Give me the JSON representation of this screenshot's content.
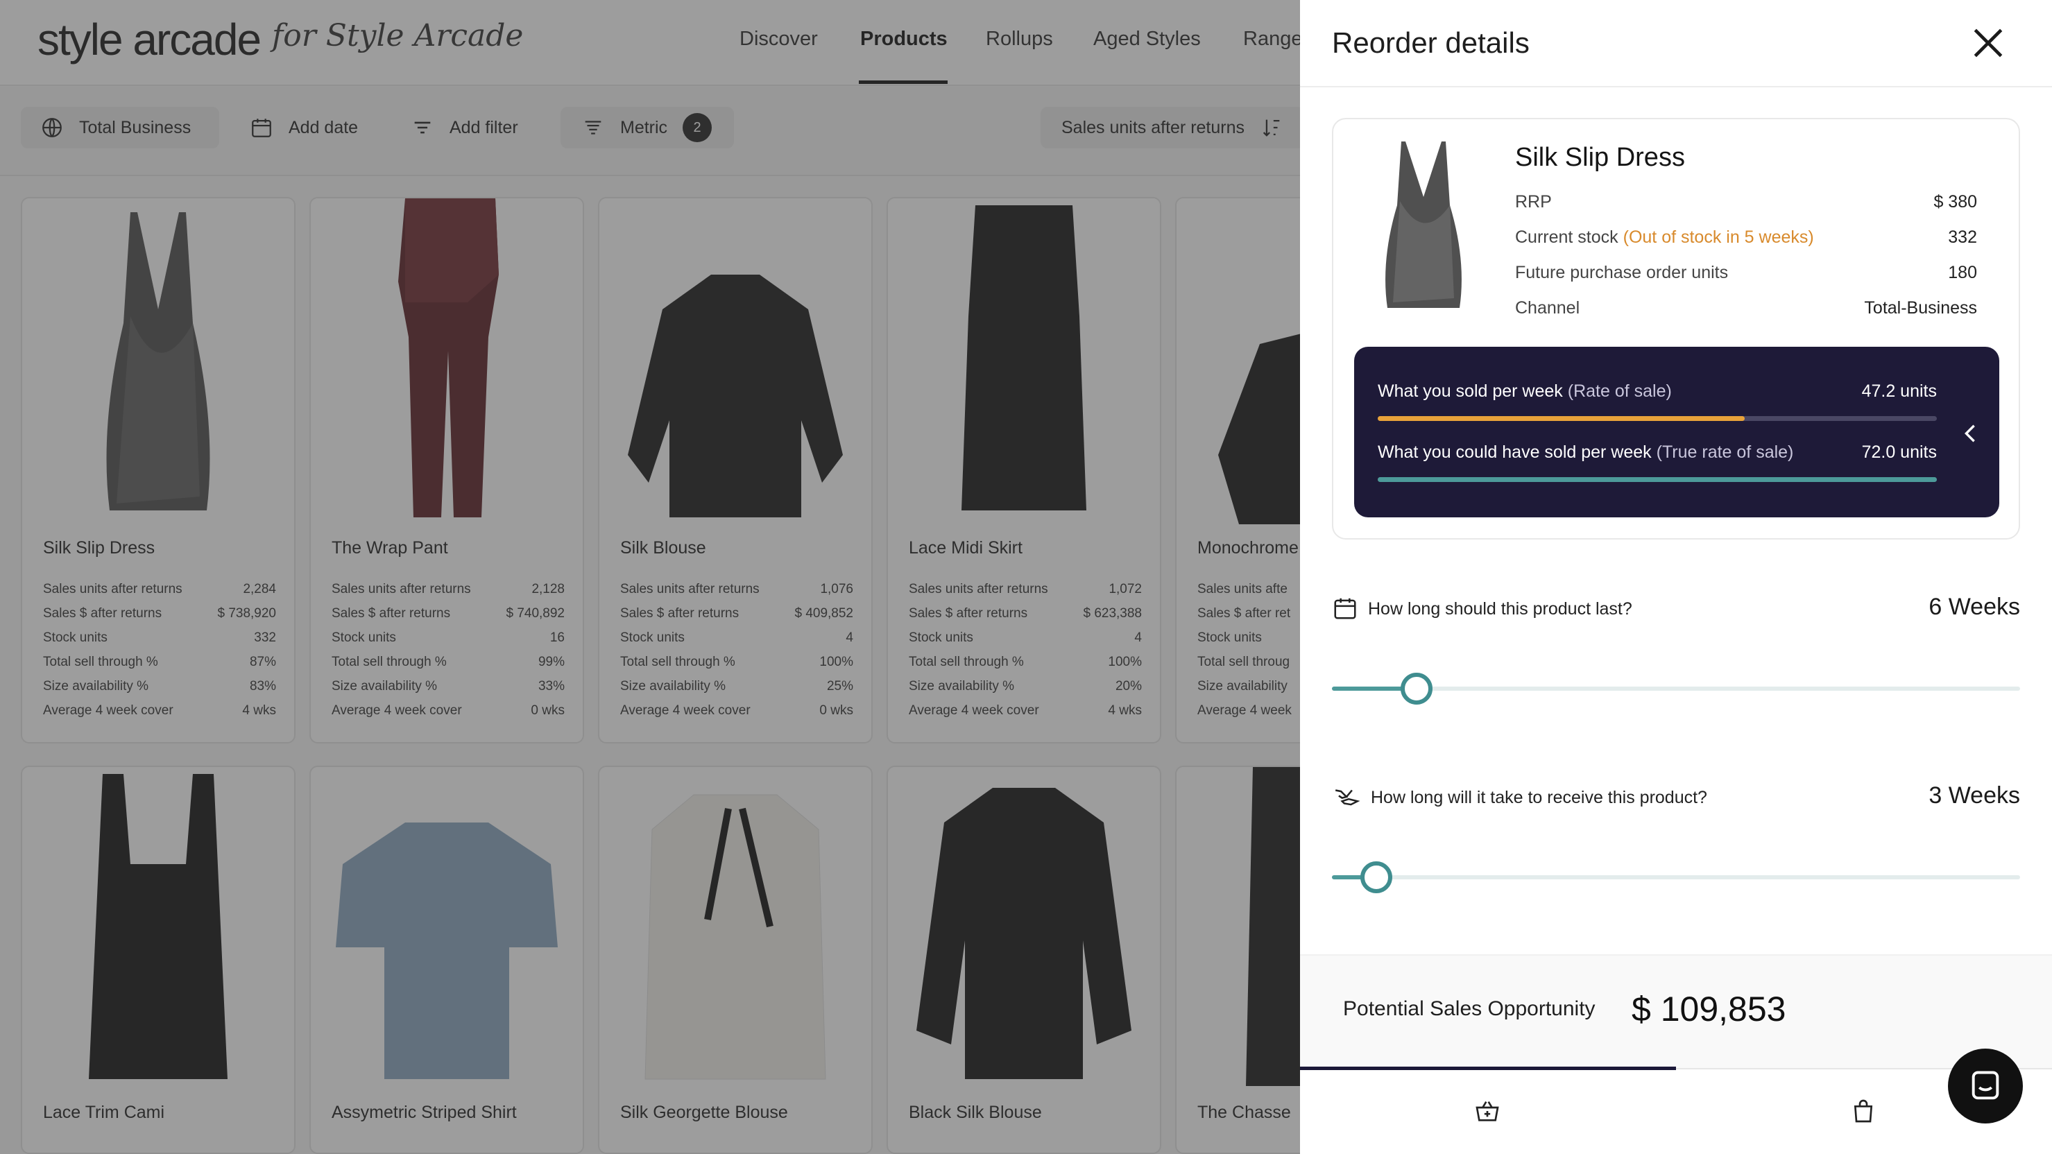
{
  "app": {
    "logo": "style arcade",
    "logo_sub": "for Style Arcade",
    "nav": [
      "Discover",
      "Products",
      "Rollups",
      "Aged Styles",
      "Range"
    ],
    "active_nav": "Products"
  },
  "filters": {
    "scope": "Total Business",
    "add_date": "Add date",
    "add_filter": "Add filter",
    "metric": "Metric",
    "metric_count": "2",
    "sort": "Sales units after returns"
  },
  "stat_labels": [
    "Sales units after returns",
    "Sales $ after returns",
    "Stock units",
    "Total sell through %",
    "Size availability %",
    "Average 4 week cover"
  ],
  "products": [
    {
      "name": "Silk Slip Dress",
      "values": [
        "2,284",
        "$ 738,920",
        "332",
        "87%",
        "83%",
        "4 wks"
      ]
    },
    {
      "name": "The Wrap Pant",
      "values": [
        "2,128",
        "$ 740,892",
        "16",
        "99%",
        "33%",
        "0 wks"
      ]
    },
    {
      "name": "Silk Blouse",
      "values": [
        "1,076",
        "$ 409,852",
        "4",
        "100%",
        "25%",
        "0 wks"
      ]
    },
    {
      "name": "Lace Midi Skirt",
      "values": [
        "1,072",
        "$ 623,388",
        "4",
        "100%",
        "20%",
        "4 wks"
      ]
    },
    {
      "name": "Monochrome",
      "labels": [
        "Sales units afte",
        "Sales $ after ret",
        "Stock units",
        "Total sell throug",
        "Size availability",
        "Average 4 week"
      ]
    }
  ],
  "products_row2": [
    "Lace Trim Cami",
    "Assymetric Striped Shirt",
    "Silk Georgette Blouse",
    "Black Silk Blouse",
    "The Chasse"
  ],
  "drawer": {
    "title": "Reorder details",
    "product_name": "Silk Slip Dress",
    "rows": [
      {
        "label": "RRP",
        "value": "$ 380"
      },
      {
        "label": "Current stock",
        "warning": "(Out of stock in 5 weeks)",
        "value": "332"
      },
      {
        "label": "Future purchase order units",
        "value": "180"
      },
      {
        "label": "Channel",
        "value": "Total-Business"
      }
    ],
    "rate": {
      "sold_label": "What you sold per week",
      "sold_sub": "(Rate of sale)",
      "sold_value": "47.2 units",
      "sold_fraction": 0.656,
      "could_label": "What you could have sold per week",
      "could_sub": "(True rate of sale)",
      "could_value": "72.0 units",
      "could_fraction": 1.0,
      "sold_color": "#e8a23a",
      "could_color": "#4d9a9a"
    },
    "q1": {
      "label": "How long should this product last?",
      "value": "6 Weeks",
      "fraction": 0.123
    },
    "q2": {
      "label": "How long will it take to receive this product?",
      "value": "3 Weeks",
      "fraction": 0.065
    },
    "opportunity": {
      "label": "Potential Sales Opportunity",
      "value": "$ 109,853"
    }
  },
  "colors": {
    "accent": "#1e1a38",
    "teal": "#3f8d8f",
    "warning": "#d88a2c"
  }
}
